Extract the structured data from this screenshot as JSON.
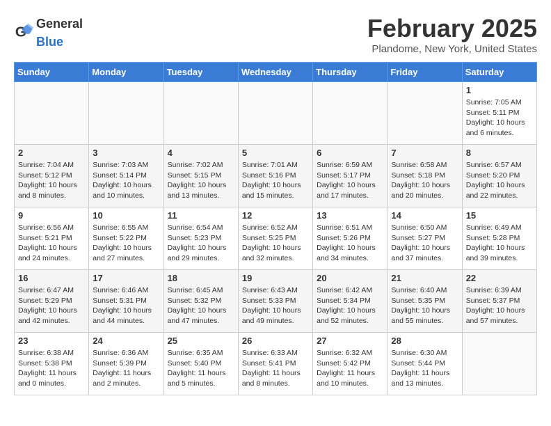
{
  "header": {
    "logo_general": "General",
    "logo_blue": "Blue",
    "month_title": "February 2025",
    "location": "Plandome, New York, United States"
  },
  "days_of_week": [
    "Sunday",
    "Monday",
    "Tuesday",
    "Wednesday",
    "Thursday",
    "Friday",
    "Saturday"
  ],
  "weeks": [
    [
      {
        "day": "",
        "text": ""
      },
      {
        "day": "",
        "text": ""
      },
      {
        "day": "",
        "text": ""
      },
      {
        "day": "",
        "text": ""
      },
      {
        "day": "",
        "text": ""
      },
      {
        "day": "",
        "text": ""
      },
      {
        "day": "1",
        "text": "Sunrise: 7:05 AM\nSunset: 5:11 PM\nDaylight: 10 hours and 6 minutes."
      }
    ],
    [
      {
        "day": "2",
        "text": "Sunrise: 7:04 AM\nSunset: 5:12 PM\nDaylight: 10 hours and 8 minutes."
      },
      {
        "day": "3",
        "text": "Sunrise: 7:03 AM\nSunset: 5:14 PM\nDaylight: 10 hours and 10 minutes."
      },
      {
        "day": "4",
        "text": "Sunrise: 7:02 AM\nSunset: 5:15 PM\nDaylight: 10 hours and 13 minutes."
      },
      {
        "day": "5",
        "text": "Sunrise: 7:01 AM\nSunset: 5:16 PM\nDaylight: 10 hours and 15 minutes."
      },
      {
        "day": "6",
        "text": "Sunrise: 6:59 AM\nSunset: 5:17 PM\nDaylight: 10 hours and 17 minutes."
      },
      {
        "day": "7",
        "text": "Sunrise: 6:58 AM\nSunset: 5:18 PM\nDaylight: 10 hours and 20 minutes."
      },
      {
        "day": "8",
        "text": "Sunrise: 6:57 AM\nSunset: 5:20 PM\nDaylight: 10 hours and 22 minutes."
      }
    ],
    [
      {
        "day": "9",
        "text": "Sunrise: 6:56 AM\nSunset: 5:21 PM\nDaylight: 10 hours and 24 minutes."
      },
      {
        "day": "10",
        "text": "Sunrise: 6:55 AM\nSunset: 5:22 PM\nDaylight: 10 hours and 27 minutes."
      },
      {
        "day": "11",
        "text": "Sunrise: 6:54 AM\nSunset: 5:23 PM\nDaylight: 10 hours and 29 minutes."
      },
      {
        "day": "12",
        "text": "Sunrise: 6:52 AM\nSunset: 5:25 PM\nDaylight: 10 hours and 32 minutes."
      },
      {
        "day": "13",
        "text": "Sunrise: 6:51 AM\nSunset: 5:26 PM\nDaylight: 10 hours and 34 minutes."
      },
      {
        "day": "14",
        "text": "Sunrise: 6:50 AM\nSunset: 5:27 PM\nDaylight: 10 hours and 37 minutes."
      },
      {
        "day": "15",
        "text": "Sunrise: 6:49 AM\nSunset: 5:28 PM\nDaylight: 10 hours and 39 minutes."
      }
    ],
    [
      {
        "day": "16",
        "text": "Sunrise: 6:47 AM\nSunset: 5:29 PM\nDaylight: 10 hours and 42 minutes."
      },
      {
        "day": "17",
        "text": "Sunrise: 6:46 AM\nSunset: 5:31 PM\nDaylight: 10 hours and 44 minutes."
      },
      {
        "day": "18",
        "text": "Sunrise: 6:45 AM\nSunset: 5:32 PM\nDaylight: 10 hours and 47 minutes."
      },
      {
        "day": "19",
        "text": "Sunrise: 6:43 AM\nSunset: 5:33 PM\nDaylight: 10 hours and 49 minutes."
      },
      {
        "day": "20",
        "text": "Sunrise: 6:42 AM\nSunset: 5:34 PM\nDaylight: 10 hours and 52 minutes."
      },
      {
        "day": "21",
        "text": "Sunrise: 6:40 AM\nSunset: 5:35 PM\nDaylight: 10 hours and 55 minutes."
      },
      {
        "day": "22",
        "text": "Sunrise: 6:39 AM\nSunset: 5:37 PM\nDaylight: 10 hours and 57 minutes."
      }
    ],
    [
      {
        "day": "23",
        "text": "Sunrise: 6:38 AM\nSunset: 5:38 PM\nDaylight: 11 hours and 0 minutes."
      },
      {
        "day": "24",
        "text": "Sunrise: 6:36 AM\nSunset: 5:39 PM\nDaylight: 11 hours and 2 minutes."
      },
      {
        "day": "25",
        "text": "Sunrise: 6:35 AM\nSunset: 5:40 PM\nDaylight: 11 hours and 5 minutes."
      },
      {
        "day": "26",
        "text": "Sunrise: 6:33 AM\nSunset: 5:41 PM\nDaylight: 11 hours and 8 minutes."
      },
      {
        "day": "27",
        "text": "Sunrise: 6:32 AM\nSunset: 5:42 PM\nDaylight: 11 hours and 10 minutes."
      },
      {
        "day": "28",
        "text": "Sunrise: 6:30 AM\nSunset: 5:44 PM\nDaylight: 11 hours and 13 minutes."
      },
      {
        "day": "",
        "text": ""
      }
    ]
  ]
}
